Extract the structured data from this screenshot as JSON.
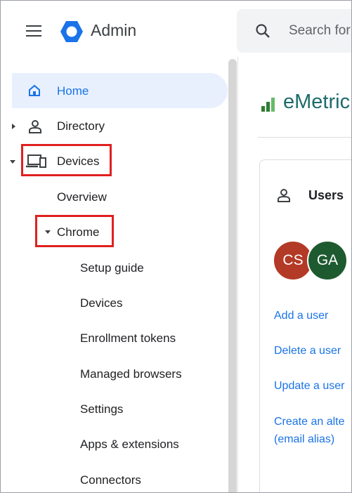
{
  "header": {
    "menu_icon": "hamburger-menu-icon",
    "app_title": "Admin",
    "search_placeholder": "Search for"
  },
  "sidebar": {
    "home": "Home",
    "directory": "Directory",
    "devices": "Devices",
    "overview": "Overview",
    "chrome": "Chrome",
    "chrome_items": [
      "Setup guide",
      "Devices",
      "Enrollment tokens",
      "Managed browsers",
      "Settings",
      "Apps & extensions",
      "Connectors"
    ]
  },
  "main": {
    "brand": "eMetric",
    "users_title": "Users",
    "avatars": [
      {
        "initials": "CS",
        "color": "#b33a26"
      },
      {
        "initials": "GA",
        "color": "#1e5a30"
      }
    ],
    "links": [
      "Add a user",
      "Delete a user",
      "Update a user",
      "Create an alte",
      "(email alias)"
    ]
  },
  "colors": {
    "accent": "#1a73e8",
    "highlight_box": "#e02020",
    "home_bg": "#e8f0fe"
  }
}
